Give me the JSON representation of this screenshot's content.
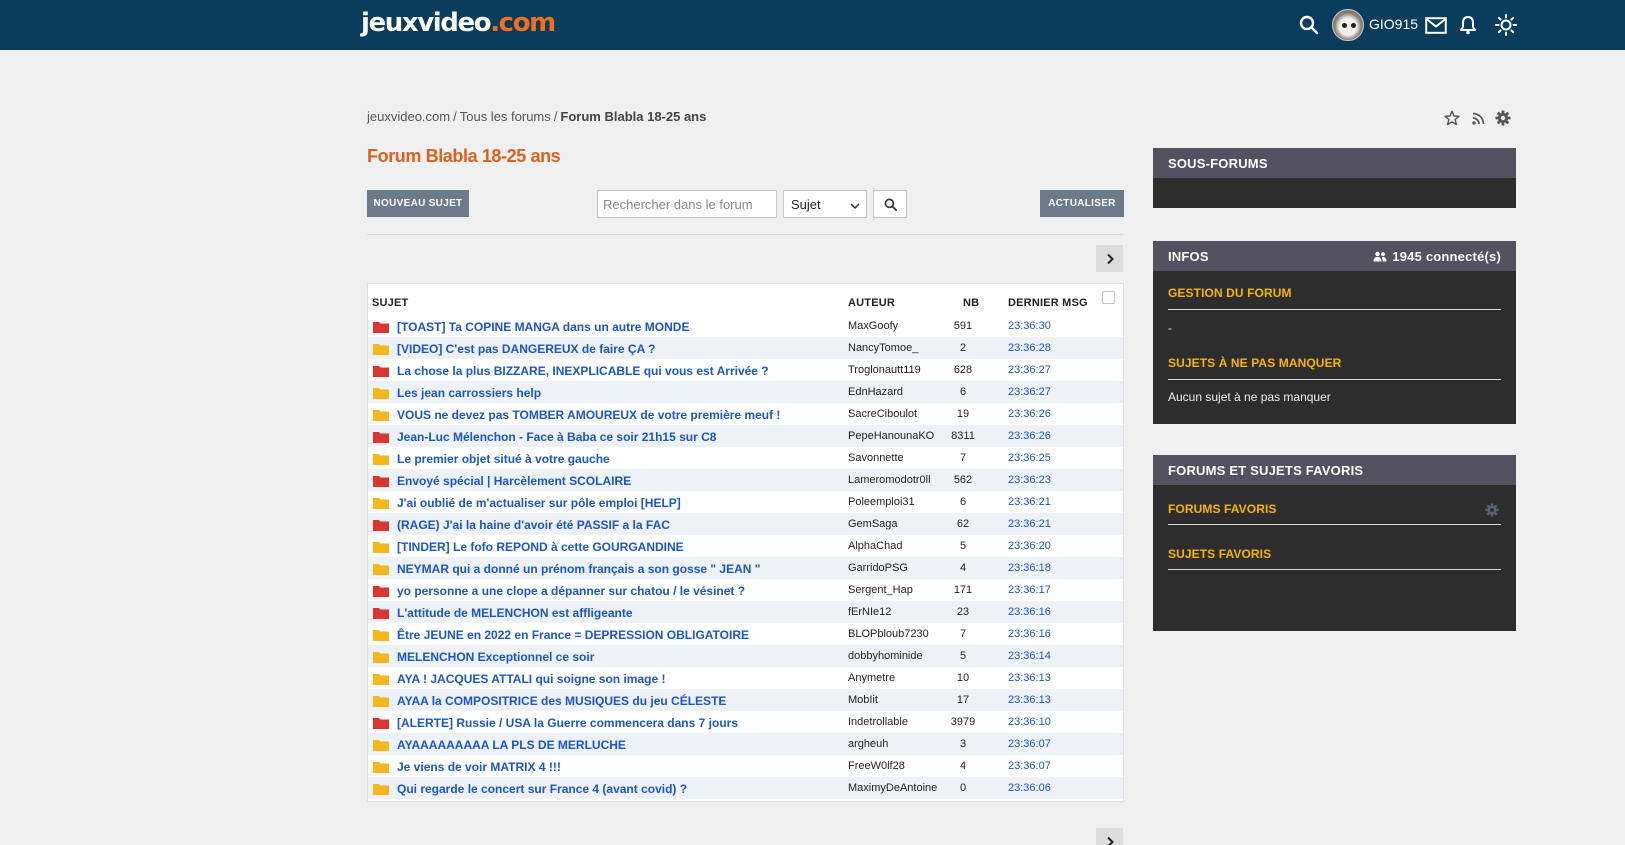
{
  "header": {
    "logo_main": "jeuxvideo",
    "logo_dot": ".com",
    "username": "GIO915"
  },
  "breadcrumb": {
    "home": "jeuxvideo.com",
    "all_forums": "Tous les forums",
    "current": "Forum Blabla 18-25 ans",
    "separator": "/"
  },
  "page_title": "Forum Blabla 18-25 ans",
  "toolbar": {
    "new_topic": "NOUVEAU SUJET",
    "search_placeholder": "Rechercher dans le forum",
    "search_type": "Sujet",
    "refresh": "ACTUALISER"
  },
  "table": {
    "headers": {
      "subject": "SUJET",
      "author": "AUTEUR",
      "nb": "NB",
      "last": "DERNIER MSG"
    },
    "rows": [
      {
        "title": "[TOAST] Ta COPINE MANGA dans un autre MONDE",
        "author": "MaxGoofy",
        "nb": "591",
        "time": "23:36:30",
        "hot": true
      },
      {
        "title": "[VIDEO] C'est pas DANGEREUX de faire ÇA ?",
        "author": "NancyTomoe_",
        "nb": "2",
        "time": "23:36:28",
        "hot": false
      },
      {
        "title": "La chose la plus BIZZARE, INEXPLICABLE qui vous est Arrivée ?",
        "author": "Troglonautt119",
        "nb": "628",
        "time": "23:36:27",
        "hot": true
      },
      {
        "title": "Les jean carrossiers help",
        "author": "EdnHazard",
        "nb": "6",
        "time": "23:36:27",
        "hot": false
      },
      {
        "title": "VOUS ne devez pas TOMBER AMOUREUX de votre première meuf !",
        "author": "SacreCiboulot",
        "nb": "19",
        "time": "23:36:26",
        "hot": false
      },
      {
        "title": "Jean-Luc Mélenchon - Face à Baba ce soir 21h15 sur C8",
        "author": "PepeHanounaKO",
        "nb": "8311",
        "time": "23:36:26",
        "hot": true
      },
      {
        "title": "Le premier objet situé à votre gauche",
        "author": "Savonnette",
        "nb": "7",
        "time": "23:36:25",
        "hot": false
      },
      {
        "title": "Envoyé spécial | Harcèlement SCOLAIRE",
        "author": "Lameromodotr0ll",
        "nb": "562",
        "time": "23:36:23",
        "hot": true
      },
      {
        "title": "J'ai oublié de m'actualiser sur pôle emploi [HELP]",
        "author": "Poleemploi31",
        "nb": "6",
        "time": "23:36:21",
        "hot": false
      },
      {
        "title": "(RAGE) J'ai la haine d'avoir été PASSIF a la FAC",
        "author": "GemSaga",
        "nb": "62",
        "time": "23:36:21",
        "hot": true
      },
      {
        "title": "[TINDER] Le fofo REPOND à cette GOURGANDINE",
        "author": "AlphaChad",
        "nb": "5",
        "time": "23:36:20",
        "hot": false
      },
      {
        "title": "NEYMAR qui a donné un prénom français a son gosse \" JEAN \"",
        "author": "GarridoPSG",
        "nb": "4",
        "time": "23:36:18",
        "hot": false
      },
      {
        "title": "yo personne a une clope a dépanner sur chatou / le vésinet ?",
        "author": "Sergent_Hap",
        "nb": "171",
        "time": "23:36:17",
        "hot": true
      },
      {
        "title": "L'attitude de MELENCHON est affligeante",
        "author": "fErNIe12",
        "nb": "23",
        "time": "23:36:16",
        "hot": true
      },
      {
        "title": "Être JEUNE en 2022 en France = DEPRESSION OBLIGATOIRE",
        "author": "BLOPbloub7230",
        "nb": "7",
        "time": "23:36:16",
        "hot": false
      },
      {
        "title": "MELENCHON Exceptionnel ce soir",
        "author": "dobbyhominide",
        "nb": "5",
        "time": "23:36:14",
        "hot": false
      },
      {
        "title": "AYA ! JACQUES ATTALI qui soigne son image !",
        "author": "Anymetre",
        "nb": "10",
        "time": "23:36:13",
        "hot": false
      },
      {
        "title": "AYAA la COMPOSITRICE des MUSIQUES du jeu CÉLESTE",
        "author": "MobIit",
        "nb": "17",
        "time": "23:36:13",
        "hot": false
      },
      {
        "title": "[ALERTE] Russie / USA la Guerre commencera dans 7 jours",
        "author": "Indetrollable",
        "nb": "3979",
        "time": "23:36:10",
        "hot": true
      },
      {
        "title": "AYAAAAAAAAA LA PLS DE MERLUCHE",
        "author": "argheuh",
        "nb": "3",
        "time": "23:36:07",
        "hot": false
      },
      {
        "title": "Je viens de voir MATRIX 4 !!!",
        "author": "FreeW0lf28",
        "nb": "4",
        "time": "23:36:07",
        "hot": false
      },
      {
        "title": "Qui regarde le concert sur France 4 (avant covid) ?",
        "author": "MaximyDeAntoine",
        "nb": "0",
        "time": "23:36:06",
        "hot": false
      }
    ]
  },
  "sidebar": {
    "subforums_title": "SOUS-FORUMS",
    "infos_title": "INFOS",
    "connected": "1945 connecté(s)",
    "manage_forum": "GESTION DU FORUM",
    "manage_value": "-",
    "must_read": "SUJETS À NE PAS MANQUER",
    "must_read_value": "Aucun sujet à ne pas manquer",
    "favorites_title": "FORUMS ET SUJETS FAVORIS",
    "fav_forums": "FORUMS FAVORIS",
    "fav_topics": "SUJETS FAVORIS"
  },
  "colors": {
    "header_bg": "#0a3c5c",
    "accent_orange": "#e0601c",
    "link_blue": "#1a56c7",
    "sidebar_gold": "#f7b500",
    "folder_red": "#d9352f",
    "folder_yellow": "#f3b71c"
  },
  "icons": [
    "search-icon",
    "mail-icon",
    "bell-icon",
    "sun-icon",
    "star-icon",
    "rss-icon",
    "gear-icon",
    "chevron-right-icon",
    "users-icon",
    "folder-icon"
  ]
}
